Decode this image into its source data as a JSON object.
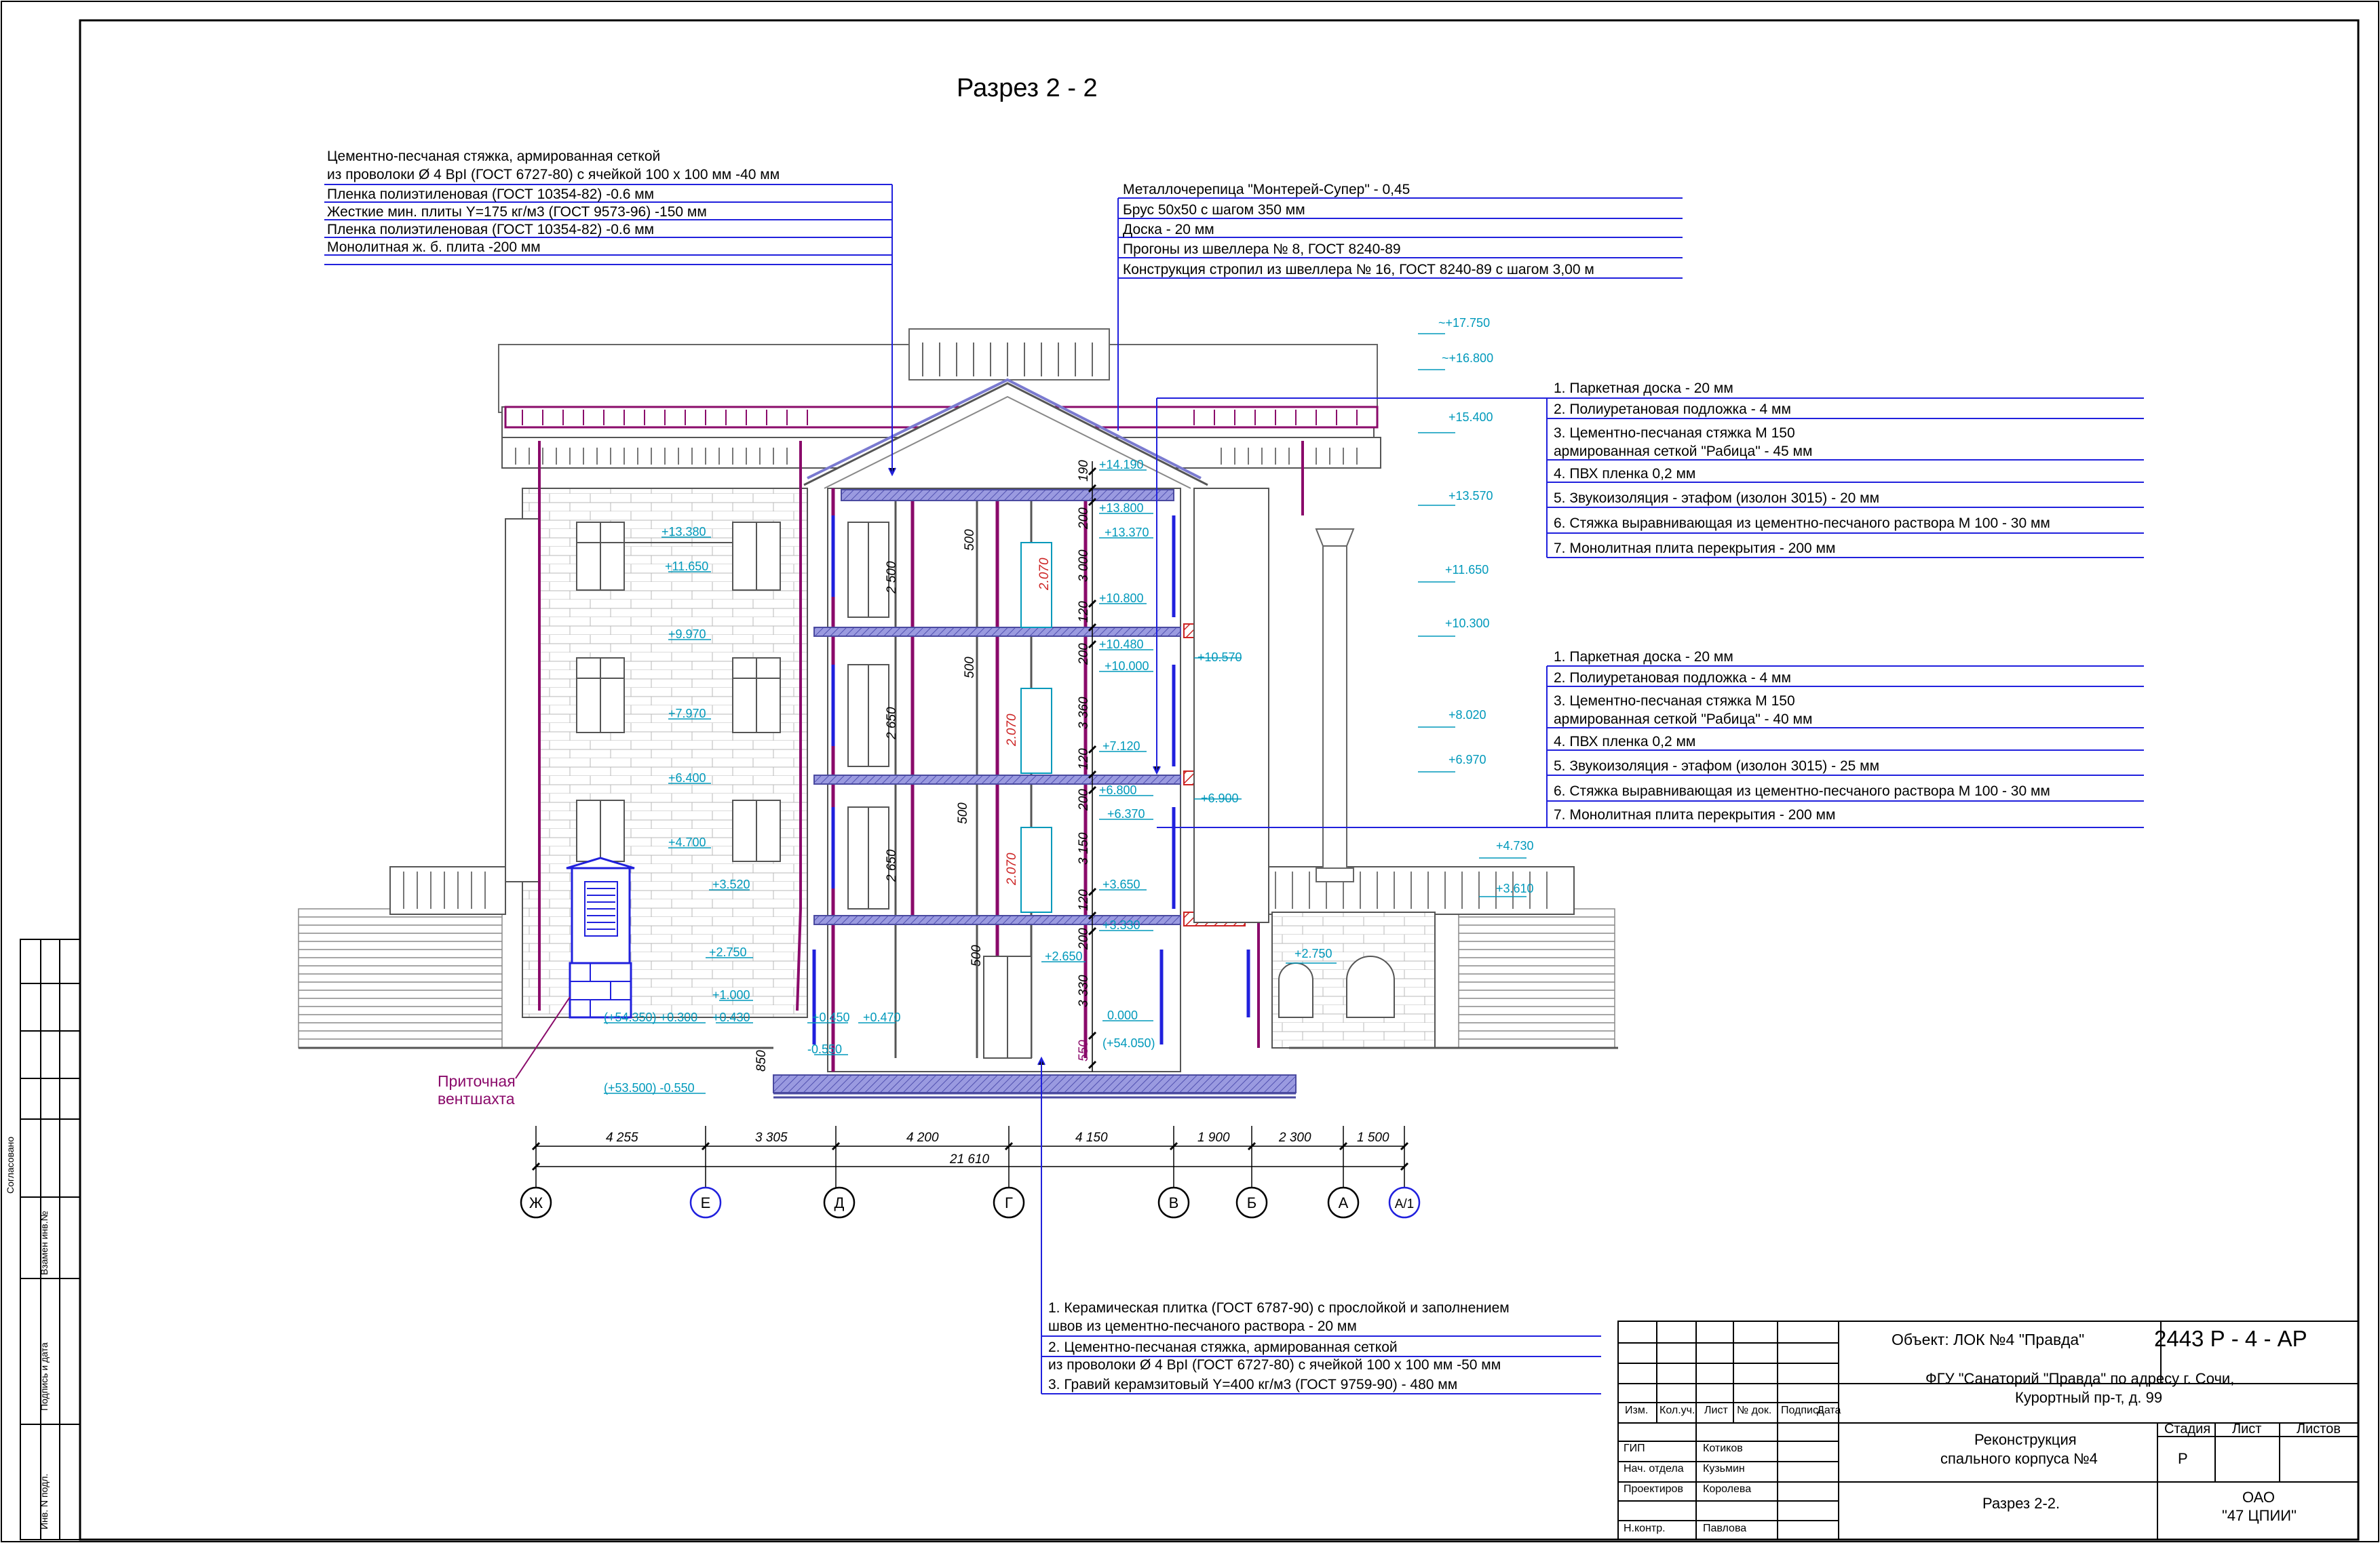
{
  "section_title": "Разрез  2 - 2",
  "roof_spec_left": [
    "Цементно-песчаная стяжка, армированная сеткой",
    "из проволоки Ø 4 ВрI (ГОСТ 6727-80) с ячейкой 100 х 100 мм      -40 мм",
    "Пленка полиэтиленовая (ГОСТ 10354-82)                                    -0.6 мм",
    "Жесткие мин. плиты Y=175 кг/м3   (ГОСТ 9573-96)                       -150 мм",
    "Пленка полиэтиленовая (ГОСТ 10354-82)                                    -0.6 мм",
    "Монолитная ж. б. плита                                                  -200 мм"
  ],
  "roof_spec_right": [
    "Металлочерепица  \"Монтерей-Супер\"  - 0,45",
    "Брус 50х50 с шагом 350 мм",
    "Доска - 20 мм",
    "Прогоны из швеллера № 8, ГОСТ 8240-89",
    "Конструкция стропил из швеллера № 16, ГОСТ 8240-89 с шагом 3,00 м"
  ],
  "floor_spec_upper": [
    "1. Паркетная доска   -   20 мм",
    "2. Полиуретановая подложка  - 4 мм",
    "3. Цементно-песчаная стяжка М 150",
    "армированная сеткой \"Рабица\"   - 45 мм",
    "4. ПВХ пленка       0,2 мм",
    "5. Звукоизоляция - этафом (изолон 3015) - 20 мм",
    "6. Стяжка выравнивающая из цементно-песчаного раствора М 100 - 30 мм",
    "7. Монолитная плита перекрытия   - 200 мм"
  ],
  "floor_spec_lower": [
    "1. Паркетная доска   -   20 мм",
    "2. Полиуретановая подложка  - 4 мм",
    "3. Цементно-песчаная стяжка М 150",
    "армированная сеткой \"Рабица\"   - 40 мм",
    "4. ПВХ пленка       0,2 мм",
    "5. Звукоизоляция - этафом (изолон 3015) - 25 мм",
    "6. Стяжка выравнивающая из цементно-песчаного раствора М 100 - 30 мм",
    "7. Монолитная плита перекрытия   - 200 мм"
  ],
  "ground_spec": [
    "1. Керамическая плитка (ГОСТ 6787-90) с прослойкой и заполнением",
    "швов из цементно-песчаного раствора                                      - 20 мм",
    "2. Цементно-песчаная стяжка, армированная сеткой",
    "из проволоки Ø 4 ВрI (ГОСТ 6727-80) с ячейкой 100 х 100 мм        -50 мм",
    "3. Гравий керамзитовый Y=400 кг/м3  (ГОСТ 9759-90)                - 480 мм"
  ],
  "vent_label": [
    "Приточная",
    "вентшахта"
  ],
  "levels_left": [
    "+13.380",
    "+11.650",
    "+9.970",
    "+7.970",
    "+6.400",
    "+4.700",
    "+3.520",
    "+2.750",
    "+1.000",
    "+0.430",
    "(+54.350) +0.300",
    "(+53.500) -0.550"
  ],
  "levels_center": [
    "+14.190",
    "+13.800",
    "+13.370",
    "+10.800",
    "+10.480",
    "+10.000",
    "+7.120",
    "+6.800",
    "+6.370",
    "+3.650",
    "+3.330",
    "+2.650",
    "+0.450",
    "+0.470",
    "-0.550",
    "0.000",
    "(+54.050)",
    "+10.570",
    "+6.900"
  ],
  "levels_right": [
    "~+17.750",
    "~+16.800",
    "+15.400",
    "+13.570",
    "+11.650",
    "+10.300",
    "+8.020",
    "+6.970",
    "+4.730",
    "+3.610",
    "+2.750"
  ],
  "vertical_dims": [
    "190",
    "200",
    "3 000",
    "120",
    "200",
    "3 360",
    "120",
    "200",
    "3 150",
    "120",
    "200",
    "3 330",
    "550",
    "2 500",
    "2 650",
    "2 650",
    "500",
    "500",
    "500",
    "500",
    "2.070",
    "2.070",
    "2.070",
    "850"
  ],
  "horizontal_dims": [
    "4 255",
    "3 305",
    "4 200",
    "4 150",
    "1 900",
    "2 300",
    "1 500"
  ],
  "total_dim": "21 610",
  "axes": [
    "Ж",
    "Е",
    "Д",
    "Г",
    "В",
    "Б",
    "А",
    "А/1"
  ],
  "side_labels": [
    "Согласовано",
    "Взамен инв.№",
    "Подпись и дата",
    "Инв. N подл."
  ],
  "stamp": {
    "object": "Объект: ЛОК №4 \"Правда\"",
    "code": "2443 Р - 4 - АР",
    "org_line1": "ФГУ \"Санаторий \"Правда\" по адресу г. Сочи,",
    "org_line2": "Курортный пр-т, д. 99",
    "header_cols": [
      "Изм.",
      "Кол.уч.",
      "Лист",
      "№ док.",
      "Подпись",
      "Дата"
    ],
    "roles": [
      "ГИП",
      "Нач. отдела",
      "Проектиров",
      "Н.контр."
    ],
    "names": [
      "Котиков",
      "Кузьмин",
      "Королева",
      "Павлова"
    ],
    "project_line1": "Реконструкция",
    "project_line2": "спального корпуса №4",
    "stage_header": "Стадия",
    "sheet_header": "Лист",
    "sheets_header": "Листов",
    "stage": "Р",
    "drawing_name": "Разрез 2-2.",
    "company_line1": "ОАО",
    "company_line2": "\"47 ЦПИИ\""
  },
  "colors": {
    "leader": "#2020dd",
    "levels": "#0099bb",
    "dims": "#8a0a6a",
    "slab": "#7a7ad0",
    "hatch": "#cc2222",
    "building": "#555555"
  }
}
